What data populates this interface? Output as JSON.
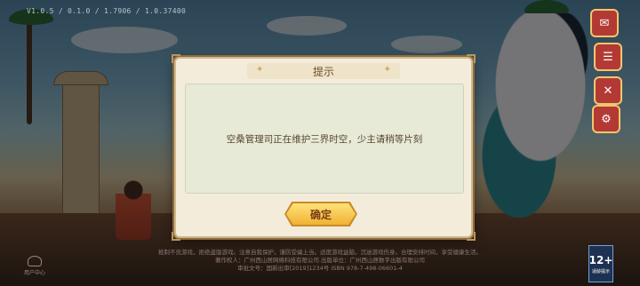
{
  "app": {
    "version": "V1.0.5 / 0.1.0 / 1.7906 / 1.0.37400"
  },
  "dialog": {
    "title": "提示",
    "message": "空桑管理司正在维护三界时空，少主请稍等片刻",
    "confirm_label": "确定"
  },
  "footer": {
    "lines": [
      "抵制不良游戏，拒绝盗版游戏。注意自我保护，谨防受骗上当。适度游戏益脑，沉迷游戏伤身。合理安排时间，享受健康生活。",
      "著作权人：广州西山居网络科技有限公司   出版单位：广州西山居数字出版有限公司",
      "审批文号：国新出审[2019]1234号   ISBN 978-7-498-06601-4"
    ]
  },
  "age_rating": {
    "value": "12+",
    "label": "适龄提示"
  },
  "left_button": {
    "label": "用户中心"
  },
  "icons": {
    "side": [
      "gift-icon",
      "mail-icon",
      "tools-icon",
      "settings-icon"
    ]
  },
  "colors": {
    "button_gold": "#f1b233",
    "dialog_bg": "#f4ecdb",
    "content_bg": "#e6ead7",
    "text_brown": "#5a4630"
  }
}
